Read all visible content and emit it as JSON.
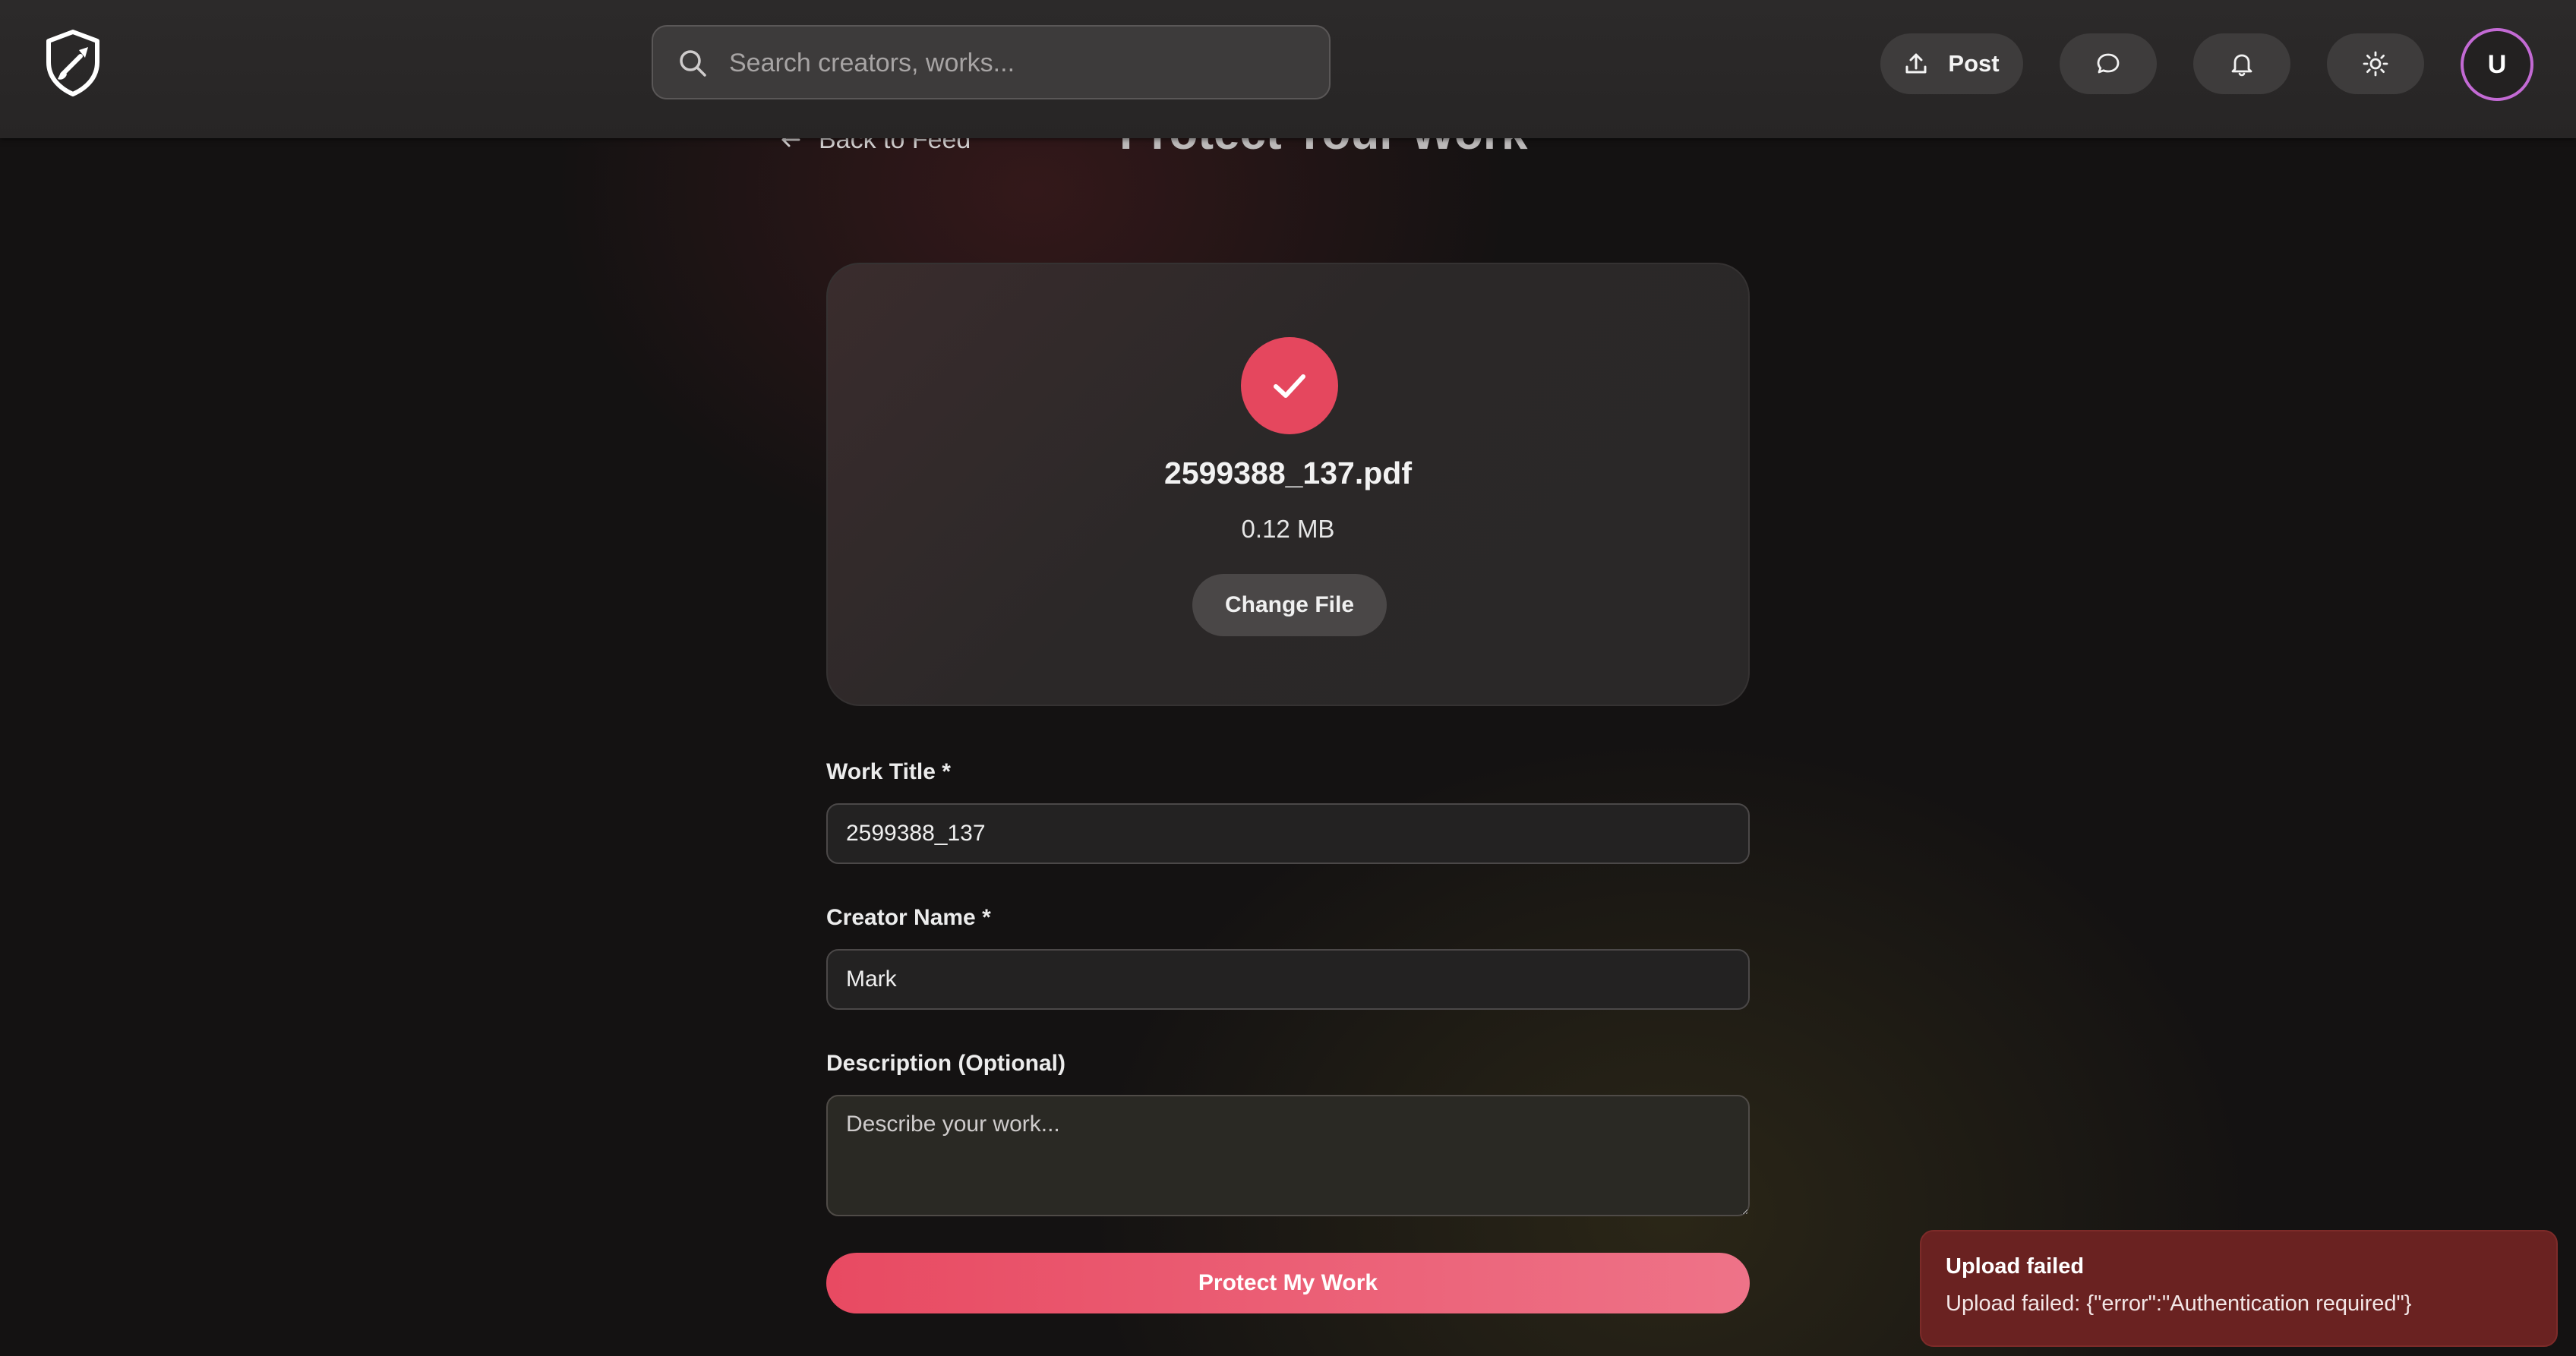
{
  "header": {
    "search_placeholder": "Search creators, works...",
    "post_label": "Post",
    "avatar_initial": "U"
  },
  "nav": {
    "back_label": "Back to Feed"
  },
  "page": {
    "title": "Protect Your Work"
  },
  "upload": {
    "file_name": "2599388_137.pdf",
    "file_size": "0.12 MB",
    "change_label": "Change File"
  },
  "form": {
    "work_title_label": "Work Title *",
    "work_title_value": "2599388_137",
    "creator_label": "Creator Name *",
    "creator_value": "Mark",
    "description_label": "Description (Optional)",
    "description_placeholder": "Describe your work...",
    "submit_label": "Protect My Work"
  },
  "toast": {
    "title": "Upload failed",
    "message": "Upload failed: {\"error\":\"Authentication required\"}"
  },
  "colors": {
    "accent": "#e5475e",
    "toast_bg": "#6a2221",
    "avatar_ring": "#c36ad4"
  },
  "icons": {
    "logo": "shield-brush-icon",
    "search": "search-icon",
    "post": "upload-icon",
    "chat": "chat-bubble-icon",
    "notifications": "bell-icon",
    "theme": "sun-icon",
    "back": "arrow-left-icon",
    "success": "checkmark-icon"
  }
}
